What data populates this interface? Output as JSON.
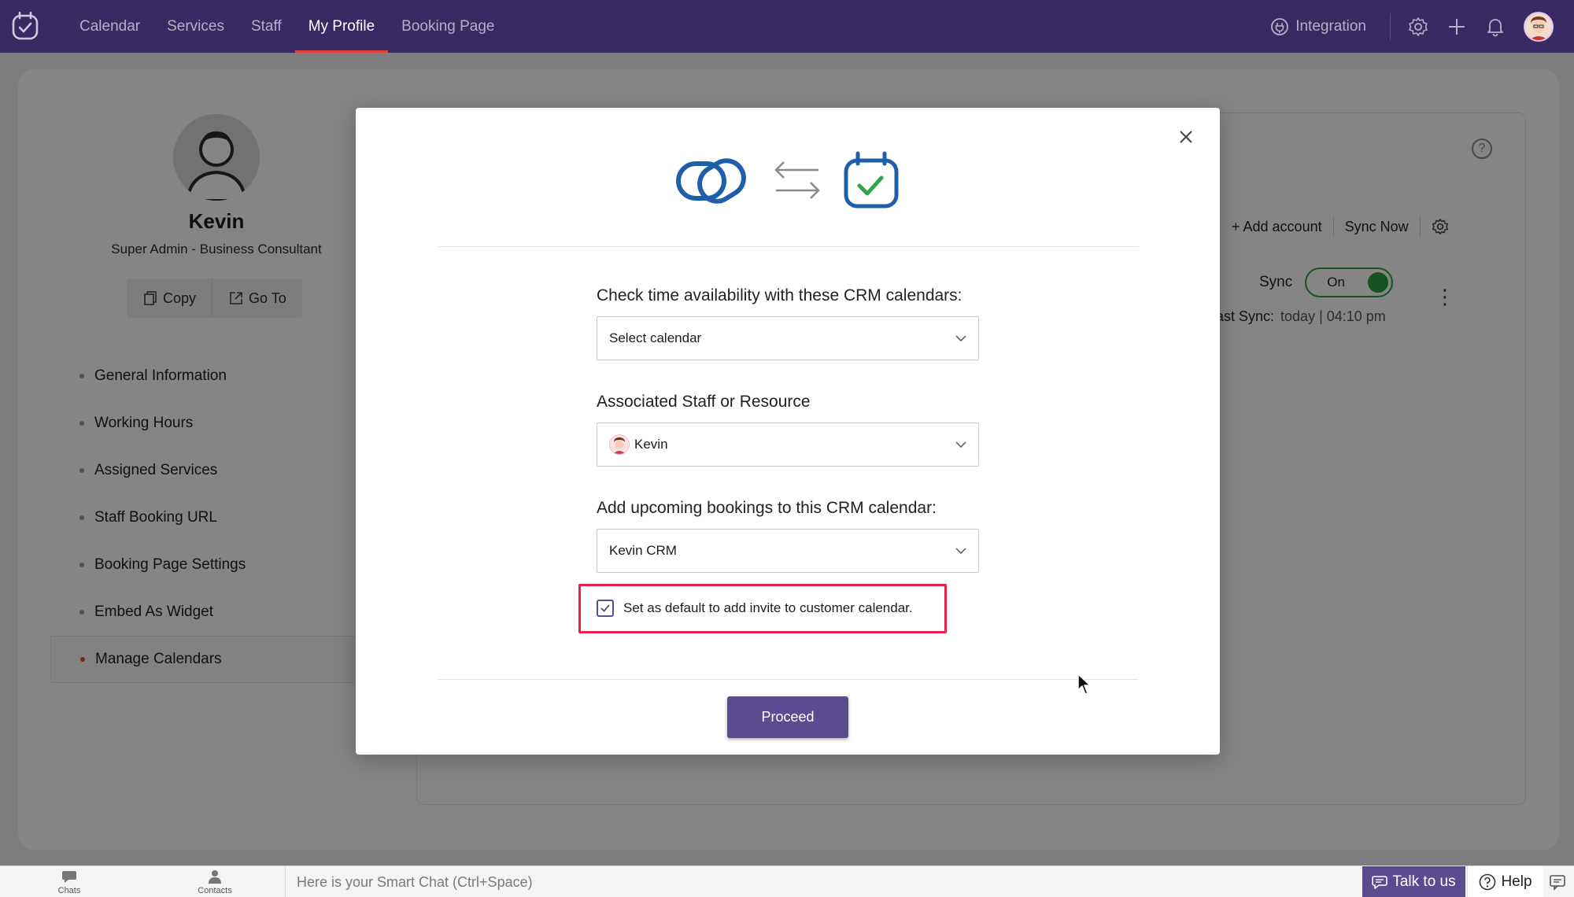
{
  "nav": {
    "items": [
      {
        "label": "Calendar"
      },
      {
        "label": "Services"
      },
      {
        "label": "Staff"
      },
      {
        "label": "My Profile",
        "active": true
      },
      {
        "label": "Booking Page"
      }
    ],
    "integration_label": "Integration"
  },
  "profile": {
    "name": "Kevin",
    "role": "Super Admin - Business Consultant",
    "copy_label": "Copy",
    "goto_label": "Go To"
  },
  "side_menu": [
    {
      "label": "General Information"
    },
    {
      "label": "Working Hours"
    },
    {
      "label": "Assigned Services"
    },
    {
      "label": "Staff Booking URL"
    },
    {
      "label": "Booking Page Settings"
    },
    {
      "label": "Embed As Widget"
    },
    {
      "label": "Manage Calendars",
      "active": true
    }
  ],
  "content": {
    "help_glyph": "?",
    "add_account_label": "+ Add account",
    "sync_now_label": "Sync Now",
    "sync_label": "Sync",
    "toggle_label": "On",
    "last_sync_label": "ast Sync:",
    "last_sync_value": "today | 04:10 pm"
  },
  "modal": {
    "crm_calendars_label": "Check time availability with these CRM calendars:",
    "crm_calendars_value": "Select calendar",
    "staff_label": "Associated Staff or Resource",
    "staff_value": "Kevin",
    "bookings_label": "Add upcoming bookings to this CRM calendar:",
    "bookings_value": "Kevin CRM",
    "default_checkbox_label": "Set as default to add invite to customer calendar.",
    "default_checkbox_checked": true,
    "proceed_label": "Proceed"
  },
  "bottom": {
    "chats_label": "Chats",
    "contacts_label": "Contacts",
    "smartchat_placeholder": "Here is your Smart Chat (Ctrl+Space)",
    "talk_label": "Talk to us",
    "help_label": "Help"
  },
  "colors": {
    "nav_bg": "#3a2a64",
    "accent": "#5a4c8e",
    "active_indicator": "#e8423f",
    "highlight": "#e8234a",
    "toggle_on": "#2f9e3f",
    "logo_blue": "#1f5faa"
  }
}
